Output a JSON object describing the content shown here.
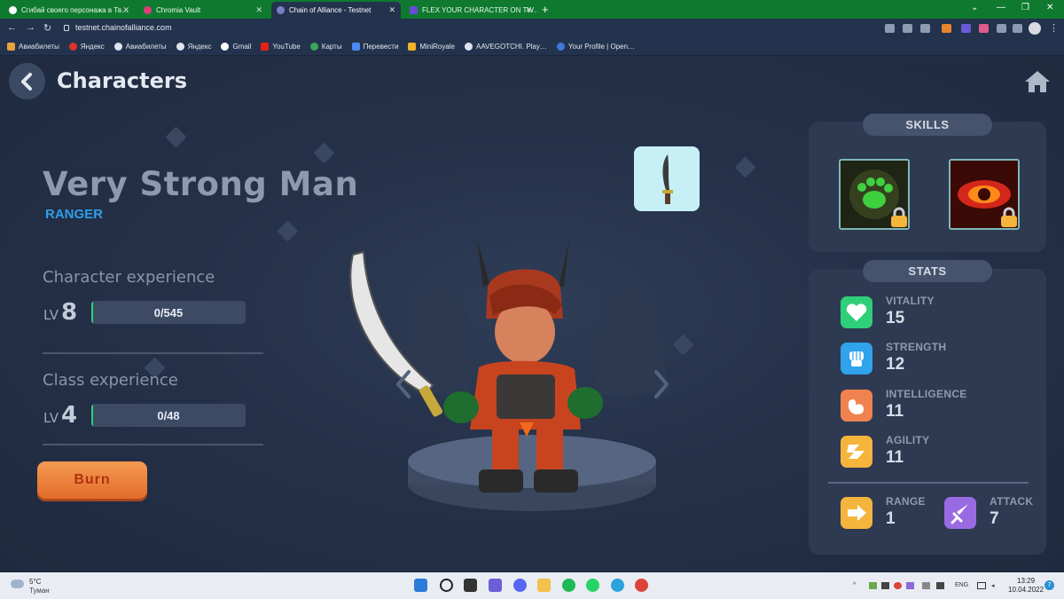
{
  "browser": {
    "tabs": [
      {
        "title": "Сгибай своего персонажа в Тв…",
        "favicon": "site-icon"
      },
      {
        "title": "Chromia Vault",
        "favicon": "chromia-icon"
      },
      {
        "title": "Chain of Alliance - Testnet",
        "favicon": "chain-icon"
      },
      {
        "title": "FLEX YOUR CHARACTER ON TW…",
        "favicon": "form-icon"
      }
    ],
    "url": "testnet.chainofalliance.com",
    "bookmarks": [
      "Авиабилеты",
      "Яндекс",
      "Авиабилеты",
      "Яндекс",
      "Gmail",
      "YouTube",
      "Карты",
      "Перевести",
      "MiniRoyale",
      "AAVEGOTCHI. Play…",
      "Your Profile | Open…"
    ]
  },
  "header": {
    "title": "Characters"
  },
  "character": {
    "name": "Very Strong Man",
    "class": "RANGER",
    "character_experience": {
      "label": "Character experience",
      "lv_label": "LV",
      "level": "8",
      "xp": "0/545",
      "progress": 0.0
    },
    "class_experience": {
      "label": "Class experience",
      "lv_label": "LV",
      "level": "4",
      "xp": "0/48",
      "progress": 0.0
    },
    "burn_label": "Burn"
  },
  "skills": {
    "title": "SKILLS",
    "items": [
      {
        "name": "green-paw-skill",
        "locked": true
      },
      {
        "name": "fire-eye-skill",
        "locked": true
      }
    ]
  },
  "stats": {
    "title": "STATS",
    "items": [
      {
        "label": "VITALITY",
        "value": "15",
        "icon": "heart-icon",
        "color": "#2fcf7a"
      },
      {
        "label": "STRENGTH",
        "value": "12",
        "icon": "fist-icon",
        "color": "#2fa3ec"
      },
      {
        "label": "INTELLIGENCE",
        "value": "11",
        "icon": "brain-icon",
        "color": "#f0824f"
      },
      {
        "label": "AGILITY",
        "value": "11",
        "icon": "wind-icon",
        "color": "#f5b43c"
      }
    ],
    "range": {
      "label": "RANGE",
      "value": "1",
      "icon": "range-arrow-icon",
      "color": "#f5b43c"
    },
    "attack": {
      "label": "ATTACK",
      "value": "7",
      "icon": "sword-icon",
      "color": "#9a6ae3"
    }
  },
  "taskbar": {
    "weather_temp": "5°C",
    "weather_desc": "Туман",
    "language": "ENG",
    "time": "13:29",
    "date": "10.04.2022",
    "notifications": "7"
  }
}
